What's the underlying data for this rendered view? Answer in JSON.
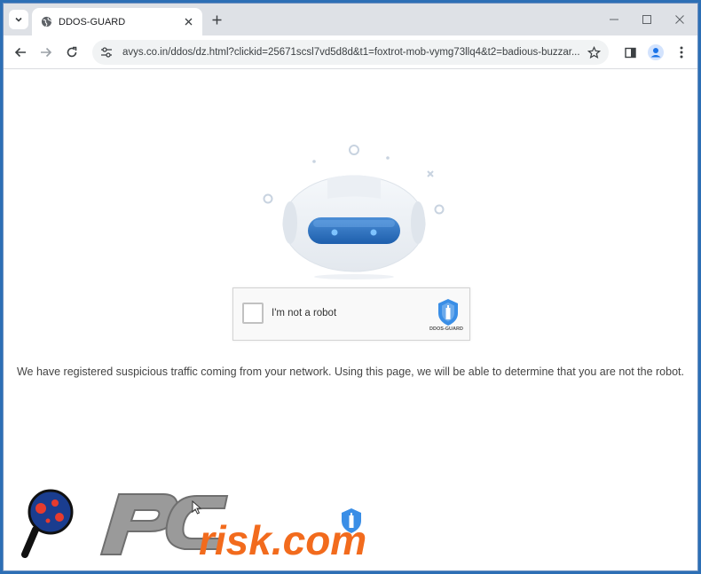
{
  "browser": {
    "tab_title": "DDOS-GUARD",
    "url": "avys.co.in/ddos/dz.html?clickid=25671scsl7vd5d8d&t1=foxtrot-mob-vymg73llq4&t2=badious-buzzar..."
  },
  "captcha": {
    "checkbox_label": "I'm not a robot",
    "brand": "DDOS-GUARD"
  },
  "page": {
    "message": "We have registered suspicious traffic coming from your network. Using this page, we will be able to determine that you are not the robot."
  },
  "watermark": {
    "text_pc": "PC",
    "text_risk": "risk.com"
  },
  "colors": {
    "accent": "#2d6fb5",
    "shield": "#3a8ee6",
    "watermark_orange": "#f26b1d",
    "watermark_grey": "#8a8a8a"
  }
}
